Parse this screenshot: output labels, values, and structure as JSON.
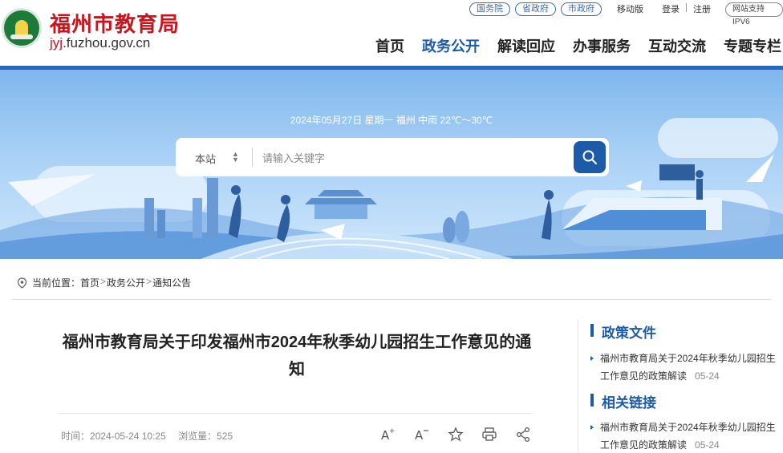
{
  "header": {
    "site_name": "福州市教育局",
    "domain_prefix": "jyj",
    "domain_rest": ".fuzhou.gov.cn",
    "top_links": [
      "国务院",
      "省政府",
      "市政府"
    ],
    "mobile": "移动版",
    "login": "登录",
    "register": "注册",
    "ipv6": "网站支持IPV6",
    "nav": [
      "首页",
      "政务公开",
      "解读回应",
      "办事服务",
      "互动交流",
      "专题专栏"
    ]
  },
  "banner": {
    "date_weather": "2024年05月27日  星期一  福州 中雨 22℃～30℃",
    "scope": "本站",
    "search_placeholder": "请输入关键字"
  },
  "breadcrumb": {
    "prefix": "当前位置：",
    "items": [
      "首页",
      "政务公开",
      "通知公告"
    ]
  },
  "article": {
    "title": "福州市教育局关于印发福州市2024年秋季幼儿园招生工作意见的通知",
    "time_label": "时间：",
    "time": "2024-05-24 10:25",
    "views_label": "浏览量：",
    "views": "525"
  },
  "sidebar": {
    "policy_title": "政策文件",
    "policy_items": [
      {
        "text": "福州市教育局关于2024年秋季幼儿园招生工作意见的政策解读",
        "date": "05-24"
      }
    ],
    "links_title": "相关链接",
    "link_items": [
      {
        "text": "福州市教育局关于2024年秋季幼儿园招生工作意见的政策解读",
        "date": "05-24"
      }
    ]
  },
  "colors": {
    "brand_red": "#c8151d",
    "brand_blue": "#1d5ba9"
  }
}
